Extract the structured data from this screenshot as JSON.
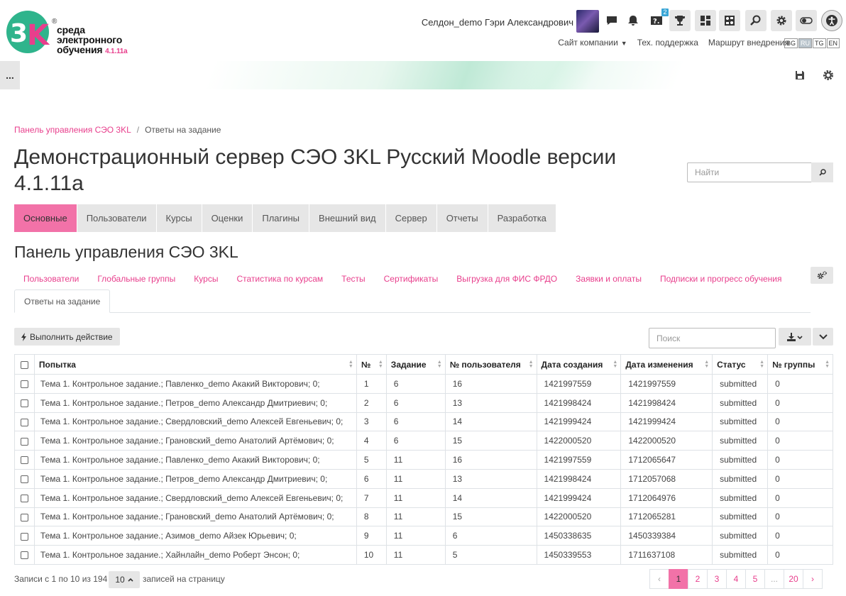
{
  "header": {
    "logo": {
      "brand": "3K",
      "line1": "среда",
      "line2": "электронного",
      "line3": "обучения",
      "version": "4.1.11a",
      "reg": "®"
    },
    "user_name": "Селдон_demo Гэри Александрович",
    "notification_badge": "2",
    "links": {
      "company": "Сайт компании",
      "support": "Тех. поддержка",
      "route": "Маршрут внедрения"
    },
    "languages": [
      "BG",
      "RU",
      "TG",
      "EN"
    ],
    "active_language": "RU"
  },
  "drawer_label": "...",
  "breadcrumb": {
    "home": "Панель управления СЭО 3KL",
    "separator": "/",
    "current": "Ответы на задание"
  },
  "page_title": "Демонстрационный сервер СЭО 3KL Русский Moodle версии 4.1.11a",
  "search": {
    "placeholder": "Найти"
  },
  "main_tabs": [
    "Основные",
    "Пользователи",
    "Курсы",
    "Оценки",
    "Плагины",
    "Внешний вид",
    "Сервер",
    "Отчеты",
    "Разработка"
  ],
  "section_title": "Панель управления СЭО 3KL",
  "sub_tabs": [
    "Пользователи",
    "Глобальные группы",
    "Курсы",
    "Статистика по курсам",
    "Тесты",
    "Сертификаты",
    "Выгрузка для ФИС ФРДО",
    "Заявки и оплаты",
    "Подписки и прогресс обучения"
  ],
  "sub_tab_active": "Ответы на задание",
  "toolbar": {
    "action_label": "Выполнить действие",
    "search_placeholder": "Поиск"
  },
  "table": {
    "columns": [
      "Попытка",
      "№",
      "Задание",
      "№ пользователя",
      "Дата создания",
      "Дата изменения",
      "Статус",
      "№ группы"
    ],
    "rows": [
      [
        "Тема 1. Контрольное задание.; Павленко_demo Акакий Викторович; 0;",
        "1",
        "6",
        "16",
        "1421997559",
        "1421997559",
        "submitted",
        "0"
      ],
      [
        "Тема 1. Контрольное задание.; Петров_demo Александр Дмитриевич; 0;",
        "2",
        "6",
        "13",
        "1421998424",
        "1421998424",
        "submitted",
        "0"
      ],
      [
        "Тема 1. Контрольное задание.; Свердловский_demo Алексей Евгеньевич; 0;",
        "3",
        "6",
        "14",
        "1421999424",
        "1421999424",
        "submitted",
        "0"
      ],
      [
        "Тема 1. Контрольное задание.; Грановский_demo Анатолий Артёмович; 0;",
        "4",
        "6",
        "15",
        "1422000520",
        "1422000520",
        "submitted",
        "0"
      ],
      [
        "Тема 1. Контрольное задание.; Павленко_demo Акакий Викторович; 0;",
        "5",
        "11",
        "16",
        "1421997559",
        "1712065647",
        "submitted",
        "0"
      ],
      [
        "Тема 1. Контрольное задание.; Петров_demo Александр Дмитриевич; 0;",
        "6",
        "11",
        "13",
        "1421998424",
        "1712057068",
        "submitted",
        "0"
      ],
      [
        "Тема 1. Контрольное задание.; Свердловский_demo Алексей Евгеньевич; 0;",
        "7",
        "11",
        "14",
        "1421999424",
        "1712064976",
        "submitted",
        "0"
      ],
      [
        "Тема 1. Контрольное задание.; Грановский_demo Анатолий Артёмович; 0;",
        "8",
        "11",
        "15",
        "1422000520",
        "1712065281",
        "submitted",
        "0"
      ],
      [
        "Тема 1. Контрольное задание.; Азимов_demo Айзек Юрьевич; 0;",
        "9",
        "11",
        "6",
        "1450338635",
        "1450339384",
        "submitted",
        "0"
      ],
      [
        "Тема 1. Контрольное задание.; Хайнлайн_demo Роберт Энсон; 0;",
        "10",
        "11",
        "5",
        "1450339553",
        "1711637108",
        "submitted",
        "0"
      ]
    ]
  },
  "footer": {
    "records_text": "Записи с 1 по 10 из 194",
    "per_page_value": "10",
    "per_page_label": "записей на страницу",
    "pages": [
      "‹",
      "1",
      "2",
      "3",
      "4",
      "5",
      "...",
      "20",
      "›"
    ],
    "current_page": "1"
  },
  "colors": {
    "accent": "#e83e8c",
    "active_tab": "#f272a8",
    "button_bg": "#e6e6e6",
    "logo_green": "#2fb48c"
  }
}
